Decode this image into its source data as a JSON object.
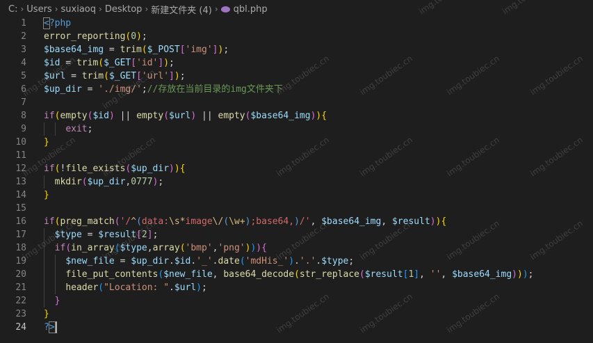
{
  "breadcrumb": {
    "items": [
      "C:",
      "Users",
      "suxiaoq",
      "Desktop",
      "新建文件夹 (4)"
    ],
    "file_icon": "php-file-icon",
    "file": "qbl.php"
  },
  "editor": {
    "active_line": 24,
    "lines": [
      {
        "n": "1",
        "tokens": [
          [
            "<?php",
            "tag"
          ]
        ]
      },
      {
        "n": "2",
        "tokens": [
          [
            "error_reporting",
            "fn"
          ],
          [
            "(",
            "br1"
          ],
          [
            "0",
            "num"
          ],
          [
            ")",
            "br1"
          ],
          [
            ";",
            "pun"
          ]
        ]
      },
      {
        "n": "3",
        "tokens": [
          [
            "$base64_img",
            "var"
          ],
          [
            " = ",
            "pun"
          ],
          [
            "trim",
            "fn"
          ],
          [
            "(",
            "br1"
          ],
          [
            "$_POST",
            "var"
          ],
          [
            "[",
            "br2"
          ],
          [
            "'img'",
            "str"
          ],
          [
            "]",
            "br2"
          ],
          [
            ")",
            "br1"
          ],
          [
            ";",
            "pun"
          ]
        ]
      },
      {
        "n": "4",
        "tokens": [
          [
            "$id",
            "var"
          ],
          [
            " = ",
            "pun"
          ],
          [
            "trim",
            "fn"
          ],
          [
            "(",
            "br1"
          ],
          [
            "$_GET",
            "var"
          ],
          [
            "[",
            "br2"
          ],
          [
            "'id'",
            "str"
          ],
          [
            "]",
            "br2"
          ],
          [
            ")",
            "br1"
          ],
          [
            ";",
            "pun"
          ]
        ]
      },
      {
        "n": "5",
        "tokens": [
          [
            "$url",
            "var"
          ],
          [
            " = ",
            "pun"
          ],
          [
            "trim",
            "fn"
          ],
          [
            "(",
            "br1"
          ],
          [
            "$_GET",
            "var"
          ],
          [
            "[",
            "br2"
          ],
          [
            "'url'",
            "str"
          ],
          [
            "]",
            "br2"
          ],
          [
            ")",
            "br1"
          ],
          [
            ";",
            "pun"
          ]
        ]
      },
      {
        "n": "6",
        "tokens": [
          [
            "$up_dir",
            "var"
          ],
          [
            " = ",
            "pun"
          ],
          [
            "'./img/'",
            "str"
          ],
          [
            ";",
            "pun"
          ],
          [
            "//存放在当前目录的img文件夹下",
            "com"
          ]
        ]
      },
      {
        "n": "7",
        "tokens": []
      },
      {
        "n": "8",
        "tokens": [
          [
            "if",
            "kw"
          ],
          [
            "(",
            "br1"
          ],
          [
            "empty",
            "fn"
          ],
          [
            "(",
            "br2"
          ],
          [
            "$id",
            "var"
          ],
          [
            ")",
            "br2"
          ],
          [
            " || ",
            "pun"
          ],
          [
            "empty",
            "fn"
          ],
          [
            "(",
            "br2"
          ],
          [
            "$url",
            "var"
          ],
          [
            ")",
            "br2"
          ],
          [
            " || ",
            "pun"
          ],
          [
            "empty",
            "fn"
          ],
          [
            "(",
            "br2"
          ],
          [
            "$base64_img",
            "var"
          ],
          [
            ")",
            "br2"
          ],
          [
            ")",
            "br1"
          ],
          [
            "{",
            "br1"
          ]
        ]
      },
      {
        "n": "9",
        "tokens": [
          [
            "    ",
            "pun"
          ],
          [
            "exit",
            "kw"
          ],
          [
            ";",
            "pun"
          ]
        ]
      },
      {
        "n": "10",
        "tokens": [
          [
            "}",
            "br1"
          ]
        ]
      },
      {
        "n": "11",
        "tokens": []
      },
      {
        "n": "12",
        "tokens": [
          [
            "if",
            "kw"
          ],
          [
            "(",
            "br1"
          ],
          [
            "!",
            "pun"
          ],
          [
            "file_exists",
            "fn"
          ],
          [
            "(",
            "br2"
          ],
          [
            "$up_dir",
            "var"
          ],
          [
            ")",
            "br2"
          ],
          [
            ")",
            "br1"
          ],
          [
            "{",
            "br1"
          ]
        ]
      },
      {
        "n": "13",
        "tokens": [
          [
            "  ",
            "pun"
          ],
          [
            "mkdir",
            "fn"
          ],
          [
            "(",
            "br2"
          ],
          [
            "$up_dir",
            "var"
          ],
          [
            ",",
            "pun"
          ],
          [
            "0777",
            "num"
          ],
          [
            ")",
            "br2"
          ],
          [
            ";",
            "pun"
          ]
        ]
      },
      {
        "n": "14",
        "tokens": [
          [
            "}",
            "br1"
          ]
        ]
      },
      {
        "n": "15",
        "tokens": []
      },
      {
        "n": "16",
        "tokens": [
          [
            "if",
            "kw"
          ],
          [
            "(",
            "br1"
          ],
          [
            "preg_match",
            "fn"
          ],
          [
            "(",
            "br2"
          ],
          [
            "'/",
            "rx"
          ],
          [
            "^",
            "rxk"
          ],
          [
            "(",
            "rxb"
          ],
          [
            "data:",
            "rx"
          ],
          [
            "\\s",
            "esc"
          ],
          [
            "*",
            "rxk"
          ],
          [
            "image",
            "rx"
          ],
          [
            "\\/",
            "esc"
          ],
          [
            "(",
            "rxb"
          ],
          [
            "\\w",
            "esc"
          ],
          [
            "+",
            "rxk"
          ],
          [
            ")",
            "rxb"
          ],
          [
            ";base64,",
            "rx"
          ],
          [
            ")",
            "rxb"
          ],
          [
            "/'",
            "rx"
          ],
          [
            ", ",
            "pun"
          ],
          [
            "$base64_img",
            "var"
          ],
          [
            ", ",
            "pun"
          ],
          [
            "$result",
            "var"
          ],
          [
            ")",
            "br2"
          ],
          [
            ")",
            "br1"
          ],
          [
            "{",
            "br1"
          ]
        ]
      },
      {
        "n": "17",
        "tokens": [
          [
            "  ",
            "pun"
          ],
          [
            "$type",
            "var"
          ],
          [
            " = ",
            "pun"
          ],
          [
            "$result",
            "var"
          ],
          [
            "[",
            "br2"
          ],
          [
            "2",
            "num"
          ],
          [
            "]",
            "br2"
          ],
          [
            ";",
            "pun"
          ]
        ]
      },
      {
        "n": "18",
        "tokens": [
          [
            "  ",
            "pun"
          ],
          [
            "if",
            "kw"
          ],
          [
            "(",
            "br2"
          ],
          [
            "in_array",
            "fn"
          ],
          [
            "(",
            "br3"
          ],
          [
            "$type",
            "var"
          ],
          [
            ",",
            "pun"
          ],
          [
            "array",
            "fn"
          ],
          [
            "(",
            "br1"
          ],
          [
            "'bmp'",
            "str"
          ],
          [
            ",",
            "pun"
          ],
          [
            "'png'",
            "str"
          ],
          [
            ")",
            "br1"
          ],
          [
            ")",
            "br3"
          ],
          [
            ")",
            "br2"
          ],
          [
            "{",
            "br2"
          ]
        ]
      },
      {
        "n": "19",
        "tokens": [
          [
            "    ",
            "pun"
          ],
          [
            "$new_file",
            "var"
          ],
          [
            " = ",
            "pun"
          ],
          [
            "$up_dir",
            "var"
          ],
          [
            ".",
            "pun"
          ],
          [
            "$id",
            "var"
          ],
          [
            ".",
            "pun"
          ],
          [
            "'_'",
            "str"
          ],
          [
            ".",
            "pun"
          ],
          [
            "date",
            "fn"
          ],
          [
            "(",
            "br3"
          ],
          [
            "'mdHis_'",
            "str"
          ],
          [
            ")",
            "br3"
          ],
          [
            ".",
            "pun"
          ],
          [
            "'.'",
            "str"
          ],
          [
            ".",
            "pun"
          ],
          [
            "$type",
            "var"
          ],
          [
            ";",
            "pun"
          ]
        ]
      },
      {
        "n": "20",
        "tokens": [
          [
            "    ",
            "pun"
          ],
          [
            "file_put_contents",
            "fn"
          ],
          [
            "(",
            "br3"
          ],
          [
            "$new_file",
            "var"
          ],
          [
            ", ",
            "pun"
          ],
          [
            "base64_decode",
            "fn"
          ],
          [
            "(",
            "br1"
          ],
          [
            "str_replace",
            "fn"
          ],
          [
            "(",
            "br2"
          ],
          [
            "$result",
            "var"
          ],
          [
            "[",
            "br3"
          ],
          [
            "1",
            "num"
          ],
          [
            "]",
            "br3"
          ],
          [
            ", ",
            "pun"
          ],
          [
            "''",
            "str"
          ],
          [
            ", ",
            "pun"
          ],
          [
            "$base64_img",
            "var"
          ],
          [
            ")",
            "br2"
          ],
          [
            ")",
            "br1"
          ],
          [
            ")",
            "br3"
          ],
          [
            ";",
            "pun"
          ]
        ]
      },
      {
        "n": "21",
        "tokens": [
          [
            "    ",
            "pun"
          ],
          [
            "header",
            "fn"
          ],
          [
            "(",
            "br3"
          ],
          [
            "\"Location: \"",
            "str"
          ],
          [
            ".",
            "pun"
          ],
          [
            "$url",
            "var"
          ],
          [
            ")",
            "br3"
          ],
          [
            ";",
            "pun"
          ]
        ]
      },
      {
        "n": "22",
        "tokens": [
          [
            "  ",
            "pun"
          ],
          [
            "}",
            "br2"
          ]
        ]
      },
      {
        "n": "23",
        "tokens": [
          [
            "}",
            "br1"
          ]
        ]
      },
      {
        "n": "24",
        "tokens": [
          [
            "?>",
            "tag"
          ]
        ]
      }
    ]
  },
  "watermark": {
    "text": "img.toubiec.cn"
  }
}
